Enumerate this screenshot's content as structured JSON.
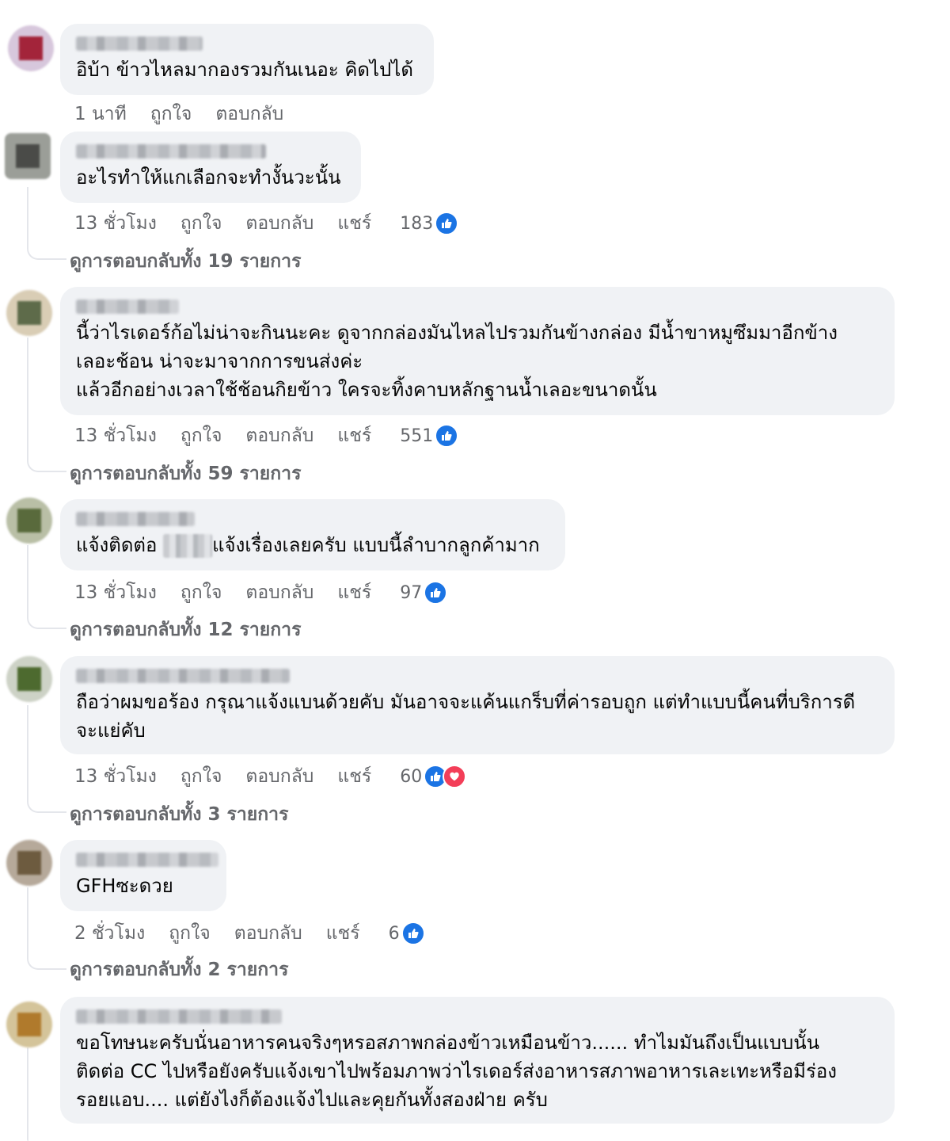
{
  "comments": [
    {
      "text": "อิบ้า ข้าวไหลมากองรวมกันเนอะ คิดไปได้",
      "time": "1 นาที",
      "like": "ถูกใจ",
      "reply": "ตอบกลับ",
      "share": "",
      "reactions": "",
      "replies": ""
    },
    {
      "text": "อะไรทำให้แกเลือกจะทำงั้นวะนั้น",
      "time": "13 ชั่วโมง",
      "like": "ถูกใจ",
      "reply": "ตอบกลับ",
      "share": "แชร์",
      "reactions": "183",
      "replies": "ดูการตอบกลับทั้ง 19 รายการ"
    },
    {
      "text": "นี้ว่าไรเดอร์ก้อไม่น่าจะกินนะคะ ดูจากกล่องมันไหลไปรวมกันข้างกล่อง มีน้ำขาหมูซึมมาอีกข้าง\nเลอะช้อน น่าจะมาจากการขนส่งค่ะ\nแล้วอีกอย่างเวลาใช้ช้อนกิยข้าว ใครจะทิ้งคาบหลักฐานน้ำเลอะขนาดนั้น",
      "time": "13 ชั่วโมง",
      "like": "ถูกใจ",
      "reply": "ตอบกลับ",
      "share": "แชร์",
      "reactions": "551",
      "replies": "ดูการตอบกลับทั้ง 59 รายการ"
    },
    {
      "text_before": "แจ้งติดต่อ ",
      "text_after": "แจ้งเรื่องเลยครับ แบบนี้ลำบากลูกค้ามาก",
      "time": "13 ชั่วโมง",
      "like": "ถูกใจ",
      "reply": "ตอบกลับ",
      "share": "แชร์",
      "reactions": "97",
      "replies": "ดูการตอบกลับทั้ง 12 รายการ"
    },
    {
      "text": "ถือว่าผมขอร้อง กรุณาแจ้งแบนด้วยคับ มันอาจจะแค้นแกร็บที่ค่ารอบถูก แต่ทำแบบนี้คนที่บริการดี\nจะแย่คับ",
      "time": "13 ชั่วโมง",
      "like": "ถูกใจ",
      "reply": "ตอบกลับ",
      "share": "แชร์",
      "reactions": "60",
      "replies": "ดูการตอบกลับทั้ง 3 รายการ"
    },
    {
      "text": "GFHซะดวย",
      "time": "2 ชั่วโมง",
      "like": "ถูกใจ",
      "reply": "ตอบกลับ",
      "share": "แชร์",
      "reactions": "6",
      "replies": "ดูการตอบกลับทั้ง 2 รายการ"
    },
    {
      "text": "ขอโทษนะครับนั่นอาหารคนจริงๆหรอสภาพกล่องข้าวเหมือนข้าว...... ทำไมมันถึงเป็นแบบนั้น\nติดต่อ CC ไปหรือยังครับแจ้งเขาไปพร้อมภาพว่าไรเดอร์ส่งอาหารสภาพอาหารเละเทะหรือมีร่อง\nรอยแอบ.... แต่ยังไงก็ต้องแจ้งไปและคุยกันทั้งสองฝ่าย ครับ",
      "time": "",
      "like": "",
      "reply": "",
      "share": "",
      "reactions": "",
      "replies": ""
    }
  ],
  "colors": {
    "bubble": "#f0f2f5",
    "meta": "#65676b",
    "like": "#1b74e4",
    "love": "#f33e58"
  }
}
